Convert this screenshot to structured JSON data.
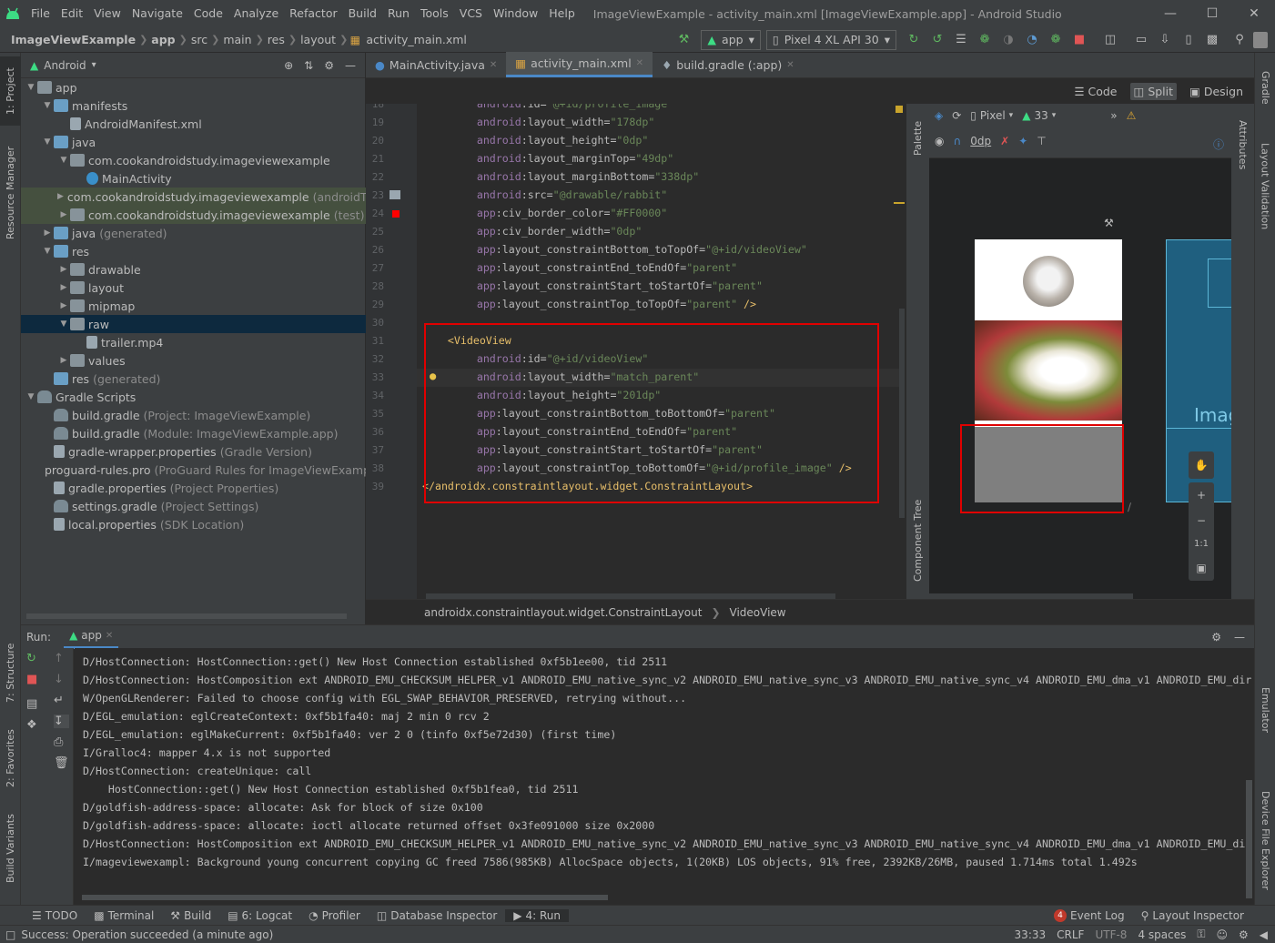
{
  "window": {
    "title": "ImageViewExample - activity_main.xml [ImageViewExample.app] - Android Studio"
  },
  "menu": [
    "File",
    "Edit",
    "View",
    "Navigate",
    "Code",
    "Analyze",
    "Refactor",
    "Build",
    "Run",
    "Tools",
    "VCS",
    "Window",
    "Help"
  ],
  "nav": {
    "breadcrumbs": [
      "ImageViewExample",
      "app",
      "src",
      "main",
      "res",
      "layout",
      "activity_main.xml"
    ],
    "run_config": "app",
    "device": "Pixel 4 XL API 30"
  },
  "project": {
    "view_label": "Android",
    "rows": [
      {
        "label": "app",
        "extra": ""
      },
      {
        "label": "manifests",
        "extra": ""
      },
      {
        "label": "AndroidManifest.xml",
        "extra": ""
      },
      {
        "label": "java",
        "extra": ""
      },
      {
        "label": "com.cookandroidstudy.imageviewexample",
        "extra": ""
      },
      {
        "label": "MainActivity",
        "extra": ""
      },
      {
        "label": "com.cookandroidstudy.imageviewexample",
        "extra": "(androidTe"
      },
      {
        "label": "com.cookandroidstudy.imageviewexample",
        "extra": "(test)"
      },
      {
        "label": "java",
        "extra": "(generated)"
      },
      {
        "label": "res",
        "extra": ""
      },
      {
        "label": "drawable",
        "extra": ""
      },
      {
        "label": "layout",
        "extra": ""
      },
      {
        "label": "mipmap",
        "extra": ""
      },
      {
        "label": "raw",
        "extra": ""
      },
      {
        "label": "trailer.mp4",
        "extra": ""
      },
      {
        "label": "values",
        "extra": ""
      },
      {
        "label": "res",
        "extra": "(generated)"
      },
      {
        "label": "Gradle Scripts",
        "extra": ""
      },
      {
        "label": "build.gradle",
        "extra": "(Project: ImageViewExample)"
      },
      {
        "label": "build.gradle",
        "extra": "(Module: ImageViewExample.app)"
      },
      {
        "label": "gradle-wrapper.properties",
        "extra": "(Gradle Version)"
      },
      {
        "label": "proguard-rules.pro",
        "extra": "(ProGuard Rules for ImageViewExample.a"
      },
      {
        "label": "gradle.properties",
        "extra": "(Project Properties)"
      },
      {
        "label": "settings.gradle",
        "extra": "(Project Settings)"
      },
      {
        "label": "local.properties",
        "extra": "(SDK Location)"
      }
    ]
  },
  "editor": {
    "tabs": [
      "MainActivity.java",
      "activity_main.xml",
      "build.gradle (:app)"
    ],
    "view_modes": [
      "Code",
      "Split",
      "Design"
    ],
    "lines": [
      {
        "n": "18",
        "a": "android",
        "b": "id",
        "v": "\"@+id/profile_image\""
      },
      {
        "n": "19",
        "a": "android",
        "b": "layout_width",
        "v": "\"178dp\""
      },
      {
        "n": "20",
        "a": "android",
        "b": "layout_height",
        "v": "\"0dp\""
      },
      {
        "n": "21",
        "a": "android",
        "b": "layout_marginTop",
        "v": "\"49dp\""
      },
      {
        "n": "22",
        "a": "android",
        "b": "layout_marginBottom",
        "v": "\"338dp\""
      },
      {
        "n": "23",
        "a": "android",
        "b": "src",
        "v": "\"@drawable/rabbit\""
      },
      {
        "n": "24",
        "a": "app",
        "b": "civ_border_color",
        "v": "\"#FF0000\""
      },
      {
        "n": "25",
        "a": "app",
        "b": "civ_border_width",
        "v": "\"0dp\""
      },
      {
        "n": "26",
        "a": "app",
        "b": "layout_constraintBottom_toTopOf",
        "v": "\"@+id/videoView\""
      },
      {
        "n": "27",
        "a": "app",
        "b": "layout_constraintEnd_toEndOf",
        "v": "\"parent\""
      },
      {
        "n": "28",
        "a": "app",
        "b": "layout_constraintStart_toStartOf",
        "v": "\"parent\""
      },
      {
        "n": "29",
        "a": "app",
        "b": "layout_constraintTop_toTopOf",
        "v": "\"parent\" />"
      },
      {
        "n": "30",
        "a": "",
        "b": "",
        "v": ""
      },
      {
        "n": "31",
        "tag": "<VideoView"
      },
      {
        "n": "32",
        "a": "android",
        "b": "id",
        "v": "\"@+id/videoView\""
      },
      {
        "n": "33",
        "a": "android",
        "b": "layout_width",
        "v": "\"match_parent\""
      },
      {
        "n": "34",
        "a": "android",
        "b": "layout_height",
        "v": "\"201dp\""
      },
      {
        "n": "35",
        "a": "app",
        "b": "layout_constraintBottom_toBottomOf",
        "v": "\"parent\""
      },
      {
        "n": "36",
        "a": "app",
        "b": "layout_constraintEnd_toEndOf",
        "v": "\"parent\""
      },
      {
        "n": "37",
        "a": "app",
        "b": "layout_constraintStart_toStartOf",
        "v": "\"parent\""
      },
      {
        "n": "38",
        "a": "app",
        "b": "layout_constraintTop_toBottomOf",
        "v": "\"@+id/profile_image\" />"
      },
      {
        "n": "39",
        "tag": "</androidx.constraintlayout.widget.ConstraintLayout>"
      }
    ],
    "breadcrumb": [
      "androidx.constraintlayout.widget.ConstraintLayout",
      "VideoView"
    ]
  },
  "design": {
    "palette": "Palette",
    "component_tree": "Component Tree",
    "device": "Pixel",
    "api": "33",
    "margin": "0dp",
    "blueprint_text": "Imag",
    "zoom_ratio": "1:1"
  },
  "run": {
    "label": "Run:",
    "config": "app",
    "log": [
      "D/HostConnection: HostConnection::get() New Host Connection established 0xf5b1ee00, tid 2511",
      "D/HostConnection: HostComposition ext ANDROID_EMU_CHECKSUM_HELPER_v1 ANDROID_EMU_native_sync_v2 ANDROID_EMU_native_sync_v3 ANDROID_EMU_native_sync_v4 ANDROID_EMU_dma_v1 ANDROID_EMU_dir",
      "W/OpenGLRenderer: Failed to choose config with EGL_SWAP_BEHAVIOR_PRESERVED, retrying without...",
      "D/EGL_emulation: eglCreateContext: 0xf5b1fa40: maj 2 min 0 rcv 2",
      "D/EGL_emulation: eglMakeCurrent: 0xf5b1fa40: ver 2 0 (tinfo 0xf5e72d30) (first time)",
      "I/Gralloc4: mapper 4.x is not supported",
      "D/HostConnection: createUnique: call",
      "    HostConnection::get() New Host Connection established 0xf5b1fea0, tid 2511",
      "D/goldfish-address-space: allocate: Ask for block of size 0x100",
      "D/goldfish-address-space: allocate: ioctl allocate returned offset 0x3fe091000 size 0x2000",
      "D/HostConnection: HostComposition ext ANDROID_EMU_CHECKSUM_HELPER_v1 ANDROID_EMU_native_sync_v2 ANDROID_EMU_native_sync_v3 ANDROID_EMU_native_sync_v4 ANDROID_EMU_dma_v1 ANDROID_EMU_dir",
      "I/mageviewexampl: Background young concurrent copying GC freed 7586(985KB) AllocSpace objects, 1(20KB) LOS objects, 91% free, 2392KB/26MB, paused 1.714ms total 1.492s"
    ]
  },
  "bottom_tabs": [
    "TODO",
    "Terminal",
    "Build",
    "6: Logcat",
    "Profiler",
    "Database Inspector",
    "4: Run"
  ],
  "bottom_right": {
    "event_log": "Event Log",
    "event_count": "4",
    "layout_inspector": "Layout Inspector"
  },
  "status": {
    "message": "Success: Operation succeeded (a minute ago)",
    "position": "33:33",
    "line_sep": "CRLF",
    "encoding": "UTF-8",
    "indent": "4 spaces"
  },
  "side_tabs": {
    "left": [
      "1: Project",
      "Resource Manager",
      "7: Structure",
      "2: Favorites",
      "Build Variants"
    ],
    "right": [
      "Gradle",
      "Attributes",
      "Layout Validation",
      "Emulator",
      "Device File Explorer"
    ]
  },
  "colors": {
    "accent": "#4a88c7",
    "highlight_box": "#e00000",
    "android_green": "#3ddc84"
  }
}
